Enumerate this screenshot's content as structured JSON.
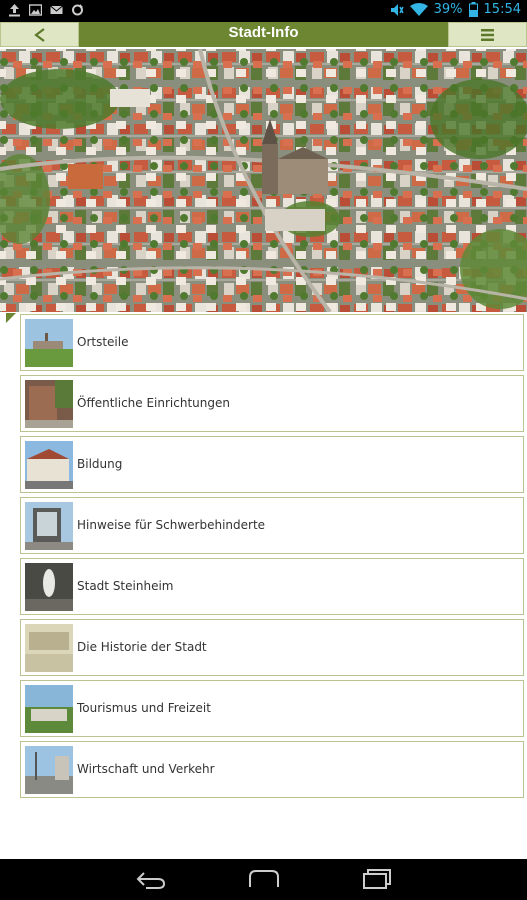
{
  "status_bar": {
    "battery": "39%",
    "time": "15:54",
    "left_icons": [
      "upload-icon",
      "image-icon",
      "mail-icon",
      "sync-icon"
    ],
    "right_icons": [
      "mute-icon",
      "wifi-icon",
      "battery-icon"
    ]
  },
  "action_bar": {
    "title": "Stadt-Info",
    "back_icon": "back-arrow-icon",
    "menu_icon": "menu-icon",
    "accent": "#6c8631"
  },
  "hero": {
    "description_icon": "town-aerial-photo"
  },
  "menu_items": [
    {
      "label": "Ortsteile",
      "thumb": "ortsteile-thumb"
    },
    {
      "label": "Öffentliche Einrichtungen",
      "thumb": "einrichtungen-thumb"
    },
    {
      "label": "Bildung",
      "thumb": "bildung-thumb"
    },
    {
      "label": "Hinweise für Schwerbehinderte",
      "thumb": "schwerbehinderte-thumb"
    },
    {
      "label": "Stadt Steinheim",
      "thumb": "steinheim-thumb"
    },
    {
      "label": "Die Historie der Stadt",
      "thumb": "historie-thumb"
    },
    {
      "label": "Tourismus und Freizeit",
      "thumb": "tourismus-thumb"
    },
    {
      "label": "Wirtschaft und Verkehr",
      "thumb": "wirtschaft-thumb"
    }
  ],
  "nav_bar": {
    "icons": [
      "nav-back-icon",
      "nav-home-icon",
      "nav-recents-icon"
    ]
  }
}
